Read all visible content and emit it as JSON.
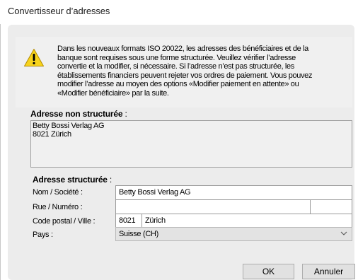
{
  "window": {
    "title": "Convertisseur d’adresses"
  },
  "info": {
    "icon": "warning-icon",
    "lines": [
      "Dans les nouveaux formats ISO 20022, les adresses des bénéficiaires et de la",
      "banque sont requises sous une forme structurée. Veuillez vérifier l’adresse",
      "convertie et la modifier, si nécessaire. Si l’adresse n’est pas structurée, les",
      "établissements financiers peuvent rejeter vos ordres de paiement. Vous pouvez",
      "modifier l’adresse au moyen des options «Modifier paiement en attente» ou",
      "«Modifier bénéficiaire» par la suite."
    ]
  },
  "unstructured": {
    "label": "Adresse non structurée",
    "colon": " :",
    "lines": [
      "Betty Bossi Verlag AG",
      "8021 Zürich"
    ]
  },
  "structured": {
    "label": "Adresse structurée",
    "colon": " :",
    "name_label": "Nom / Société :",
    "name_value": "Betty Bossi Verlag AG",
    "street_label": "Rue / Numéro :",
    "street_value": "",
    "number_value": "",
    "zip_label": "Code postal / Ville :",
    "zip_value": "8021",
    "city_value": "Zürich",
    "country_label": "Pays :",
    "country_value": "Suisse (CH)"
  },
  "buttons": {
    "ok": "OK",
    "cancel": "Annuler"
  },
  "colors": {
    "warning_fill": "#f7d31c",
    "panel_bg": "#ececec"
  }
}
